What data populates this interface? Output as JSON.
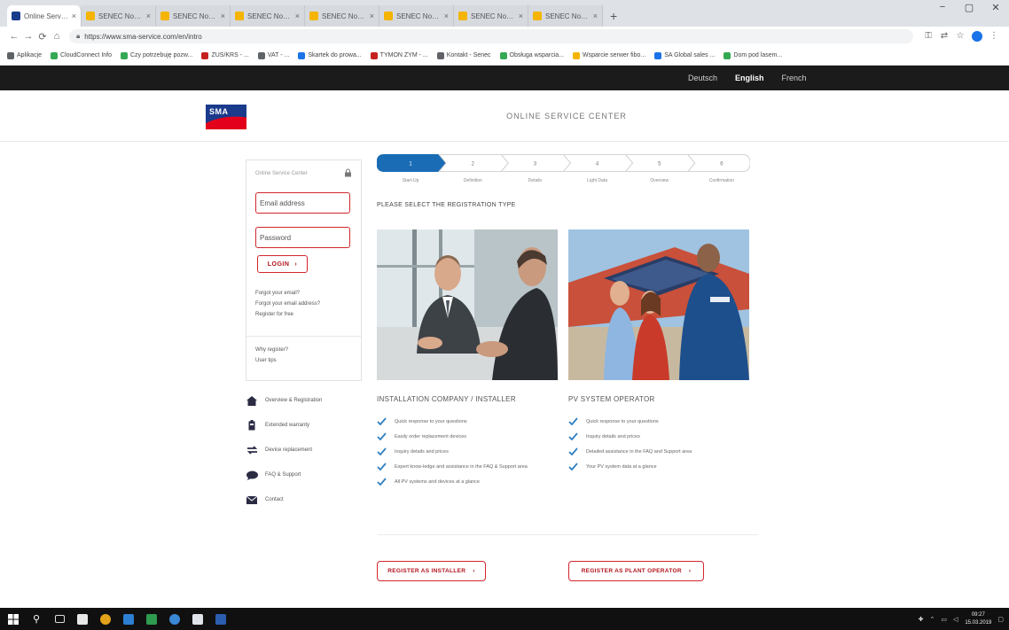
{
  "browser": {
    "tabs": [
      {
        "label": "Online Service Center - SMA So...",
        "icon_color": "#1a3a8c",
        "active": true
      },
      {
        "label": "SENEC Nowoczesne systemy sol...",
        "icon_color": "#f4b400",
        "active": false
      },
      {
        "label": "SENEC Nowoczesne systemy sol...",
        "icon_color": "#f4b400",
        "active": false
      },
      {
        "label": "SENEC Nowoczesne systemy sol...",
        "icon_color": "#f4b400",
        "active": false
      },
      {
        "label": "SENEC Nowoczesne systemy sol...",
        "icon_color": "#f4b400",
        "active": false
      },
      {
        "label": "SENEC Nowoczesne systemy sol...",
        "icon_color": "#f4b400",
        "active": false
      },
      {
        "label": "SENEC Nowoczesne systemy sol...",
        "icon_color": "#f4b400",
        "active": false
      },
      {
        "label": "SENEC Nowoczesne systemy sol...",
        "icon_color": "#f4b400",
        "active": false
      }
    ],
    "new_tab": "+",
    "window_controls": {
      "minimize": "−",
      "maximize": "▢",
      "close": "✕"
    },
    "url": "https://www.sma-service.com/en/intro",
    "bookmarks": [
      {
        "label": "Aplikacje",
        "color": "#5f6368"
      },
      {
        "label": "CloudConnect Info",
        "color": "#34a853"
      },
      {
        "label": "Czy potrzebuję pozw...",
        "color": "#34a853"
      },
      {
        "label": "ZUS/KRS - ...",
        "color": "#c5221f"
      },
      {
        "label": "VAT - ...",
        "color": "#5f6368"
      },
      {
        "label": "Skartek do prowa...",
        "color": "#1a73e8"
      },
      {
        "label": "TYMON ZYM - ...",
        "color": "#c5221f"
      },
      {
        "label": "Kontakt - Senec",
        "color": "#5f6368"
      },
      {
        "label": "Obsługa wsparcia...",
        "color": "#34a853"
      },
      {
        "label": "Wsparcie serwer fibo...",
        "color": "#f4b400"
      },
      {
        "label": "SA Global sales ...",
        "color": "#1a73e8"
      },
      {
        "label": "Dom pod lasem...",
        "color": "#34a853"
      }
    ]
  },
  "site": {
    "languages": [
      {
        "label": "Deutsch",
        "active": false
      },
      {
        "label": "English",
        "active": true
      },
      {
        "label": "French",
        "active": false
      }
    ],
    "logo_text": "SMA",
    "header_title": "ONLINE SERVICE CENTER"
  },
  "login": {
    "heading": "Online Service Center",
    "email_placeholder": "Email address",
    "password_placeholder": "Password",
    "login_button": "LOGIN",
    "links": [
      "Forgot your email?",
      "Forgot your email address?",
      "Register for free"
    ],
    "links2": [
      "Why register?",
      "User tips"
    ]
  },
  "sidenav": [
    {
      "label": "Overview & Registration",
      "icon": "house-icon"
    },
    {
      "label": "Extended warranty",
      "icon": "battery-icon"
    },
    {
      "label": "Device replacement",
      "icon": "swap-icon"
    },
    {
      "label": "FAQ & Support",
      "icon": "chat-icon"
    },
    {
      "label": "Contact",
      "icon": "mail-icon"
    }
  ],
  "steps": {
    "numbers": [
      "1",
      "2",
      "3",
      "4",
      "5",
      "6"
    ],
    "labels": [
      "Start-Up",
      "Definition",
      "Details",
      "Light Data",
      "Overview",
      "Confirmation"
    ],
    "active_index": 0,
    "active_color": "#1a6cb5"
  },
  "main": {
    "heading": "PLEASE SELECT THE REGISTRATION TYPE",
    "installer": {
      "title": "INSTALLATION COMPANY / INSTALLER",
      "items": [
        "Quick response to your questions",
        "Easily order replacement devices",
        "Inquiry details and prices",
        "Expert know-ledge and assistance in the FAQ & Support area",
        "All PV systems and devices at a glance"
      ],
      "button": "REGISTER AS INSTALLER"
    },
    "operator": {
      "title": "PV SYSTEM OPERATOR",
      "items": [
        "Quick response to your questions",
        "Inquiry details and prices",
        "Detailed assistance in the FAQ and Support area",
        "Your PV system data at a glance"
      ],
      "button": "REGISTER AS PLANT OPERATOR"
    },
    "check_color": "#2e7fc1"
  },
  "taskbar": {
    "clock_time": "09:27",
    "clock_date": "15.03.2019"
  }
}
